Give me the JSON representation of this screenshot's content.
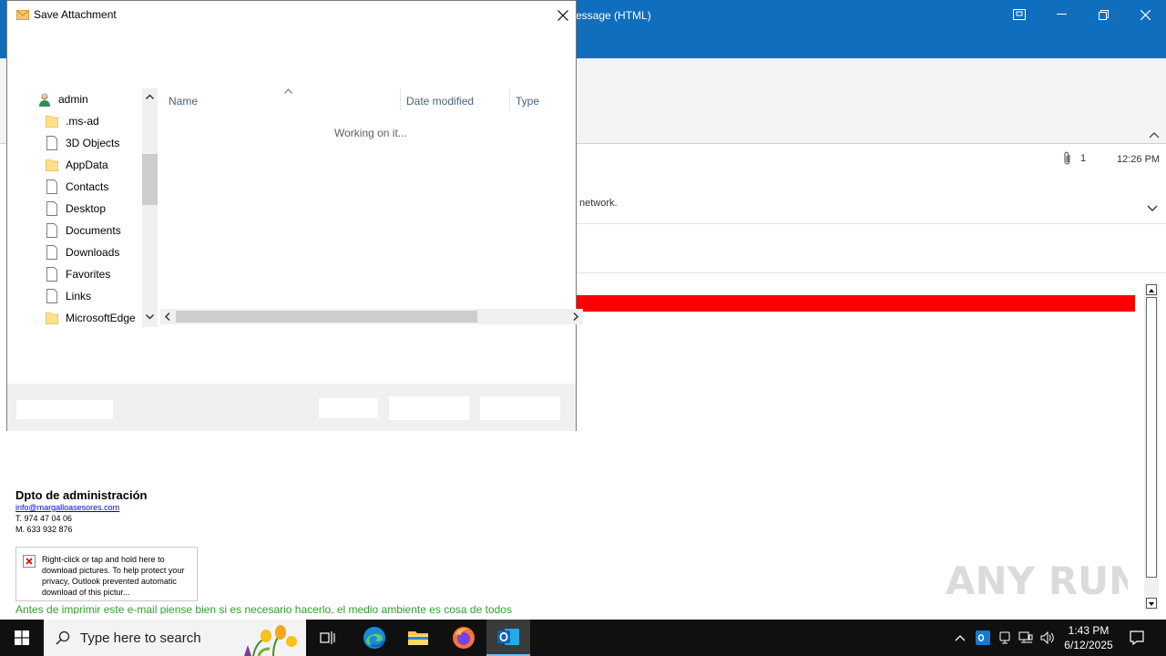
{
  "outlook": {
    "title_fragment": "essage (HTML)",
    "window_controls": [
      "restore-mode",
      "minimize",
      "maximize",
      "close"
    ],
    "attachment_count": "1",
    "time": "12:26 PM",
    "info_line": "network.",
    "body": {
      "banner_color": "#ff0000",
      "signature_name": "Dpto de administración",
      "signature_email": "info@margalloasesores.com",
      "signature_tel": "T. 974 47 04 06",
      "signature_mobile": "M. 633 932 876",
      "image_placeholder_text": "Right-click or tap and hold here to download pictures. To help protect your privacy, Outlook prevented automatic download of this pictur...",
      "footer_note": "Antes de imprimir este e-mail piense bien si es necesario hacerlo, el medio ambiente es cosa de todos"
    }
  },
  "dialog": {
    "title": "Save Attachment",
    "nav": [
      {
        "label": "admin",
        "icon": "user-icon"
      },
      {
        "label": ".ms-ad",
        "icon": "folder-icon"
      },
      {
        "label": "3D Objects",
        "icon": "file-icon"
      },
      {
        "label": "AppData",
        "icon": "folder-icon"
      },
      {
        "label": "Contacts",
        "icon": "file-icon"
      },
      {
        "label": "Desktop",
        "icon": "file-icon"
      },
      {
        "label": "Documents",
        "icon": "file-icon"
      },
      {
        "label": "Downloads",
        "icon": "file-icon"
      },
      {
        "label": "Favorites",
        "icon": "file-icon"
      },
      {
        "label": "Links",
        "icon": "file-icon"
      },
      {
        "label": "MicrosoftEdge",
        "icon": "folder-icon"
      }
    ],
    "columns": [
      "Name",
      "Date modified",
      "Type"
    ],
    "status": "Working on it..."
  },
  "taskbar": {
    "search_placeholder": "Type here to search",
    "time": "1:43 PM",
    "date": "6/12/2025",
    "accent": "#76b9ed"
  },
  "watermark": "ANY RUN"
}
